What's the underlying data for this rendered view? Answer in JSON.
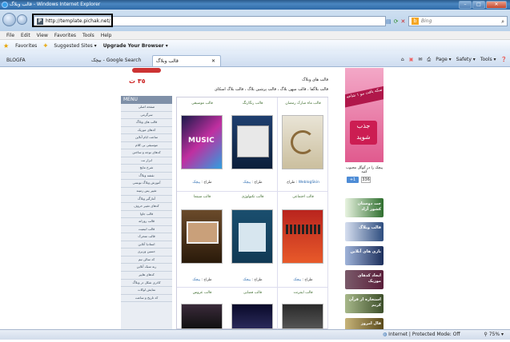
{
  "window": {
    "title": "قالب وبلاگ - Windows Internet Explorer"
  },
  "address": {
    "url": "http://template.pichak.net/",
    "search_placeholder": "Bing"
  },
  "menu": [
    "File",
    "Edit",
    "View",
    "Favorites",
    "Tools",
    "Help"
  ],
  "favbar": {
    "favorites": "Favorites",
    "suggested": "Suggested Sites ▾",
    "upgrade": "Upgrade Your Browser ▾"
  },
  "tabs": [
    {
      "label": "BLOGFA"
    },
    {
      "label": "بیچک - Google Search"
    },
    {
      "label": "قالب وبلاگ"
    }
  ],
  "cmd": [
    "Page ▾",
    "Safety ▾",
    "Tools ▾"
  ],
  "left": {
    "price": "٣٥ ت",
    "menu_head": "MENU",
    "items": [
      "صفحه اصلی",
      "سرگرمی",
      "قالب های وبلاگ",
      "کدهای موزیک",
      "ساعت ایام آنلاین",
      "موسیقی بی کلام",
      "کدهای توجه و ساختن",
      "ابزار نت",
      "شرح نتایج",
      "نقشه وبلاگ",
      "آموزش وبلاگ نویسی",
      "تغییر پس زمینه",
      "آمارگیر وبلاگ",
      "کدهای تغییر حروف",
      "قالب جاوا",
      "قالب روزانه",
      "قالب انیمیت",
      "قالب متحرک",
      "استادیا آنلاین",
      "حسین وزیری",
      "کد سالن تیم",
      "ربه سبک آنلاین",
      "کدهای هایپر",
      "کادری شکل در وبلاگ",
      "نمایش لوکات",
      "کد تاریخ و ساعت"
    ]
  },
  "main": {
    "title": "قالب های وبلاگ",
    "crumbs": "قالب بلاگفا ، قالب میهن بلاگ ، قالب پرشین بلاگ ، قالب بلاگ اسکای",
    "rows": [
      [
        {
          "title": "قالب ماه مبارک رمضان",
          "design_label": "طراح :",
          "designer": "WeblogSkin"
        },
        {
          "title": "قالب رنگارنگ",
          "design_label": "طراح :",
          "designer": "پیچک"
        },
        {
          "title": "قالب موسیقی",
          "design_label": "طراح :",
          "designer": "پیچک"
        }
      ],
      [
        {
          "title": "قالب اجتماعی",
          "design_label": "طراح :",
          "designer": "پیچک"
        },
        {
          "title": "قالب تکنولوژی",
          "design_label": "طراح :",
          "designer": "پیچک"
        },
        {
          "title": "قالب سینما",
          "design_label": "طراح :",
          "designer": "پیچک"
        }
      ],
      [
        {
          "title": "قالب اینترنت"
        },
        {
          "title": "قالب فضایی"
        },
        {
          "title": "قالب عروس"
        }
      ]
    ]
  },
  "right": {
    "promo_ribbon": "سکه بافت مو ١ شاخه",
    "promo_jazb": "جذب شوید",
    "fb_text": "پیچک را در گوگل محبوب کنید",
    "gplus_label": "+1",
    "gplus_count": "336",
    "ads": [
      {
        "text": "چت دوستان کشور آزاد",
        "color": "#2f6f2f"
      },
      {
        "text": "قالب وبلاگ",
        "color": "#2e4d7f"
      },
      {
        "text": "بازی های آنلاین",
        "color": "#1c2f5c"
      },
      {
        "text": "ایجاد کدهای موزیک",
        "color": "#5a1f3a"
      },
      {
        "text": "استخاره از قرآن کریم",
        "color": "#3d4f2a"
      },
      {
        "text": "فال امروز",
        "color": "#5a4a1a"
      }
    ]
  },
  "status": {
    "zone": "Internet | Protected Mode: Off",
    "zoom": "75% ▾"
  }
}
